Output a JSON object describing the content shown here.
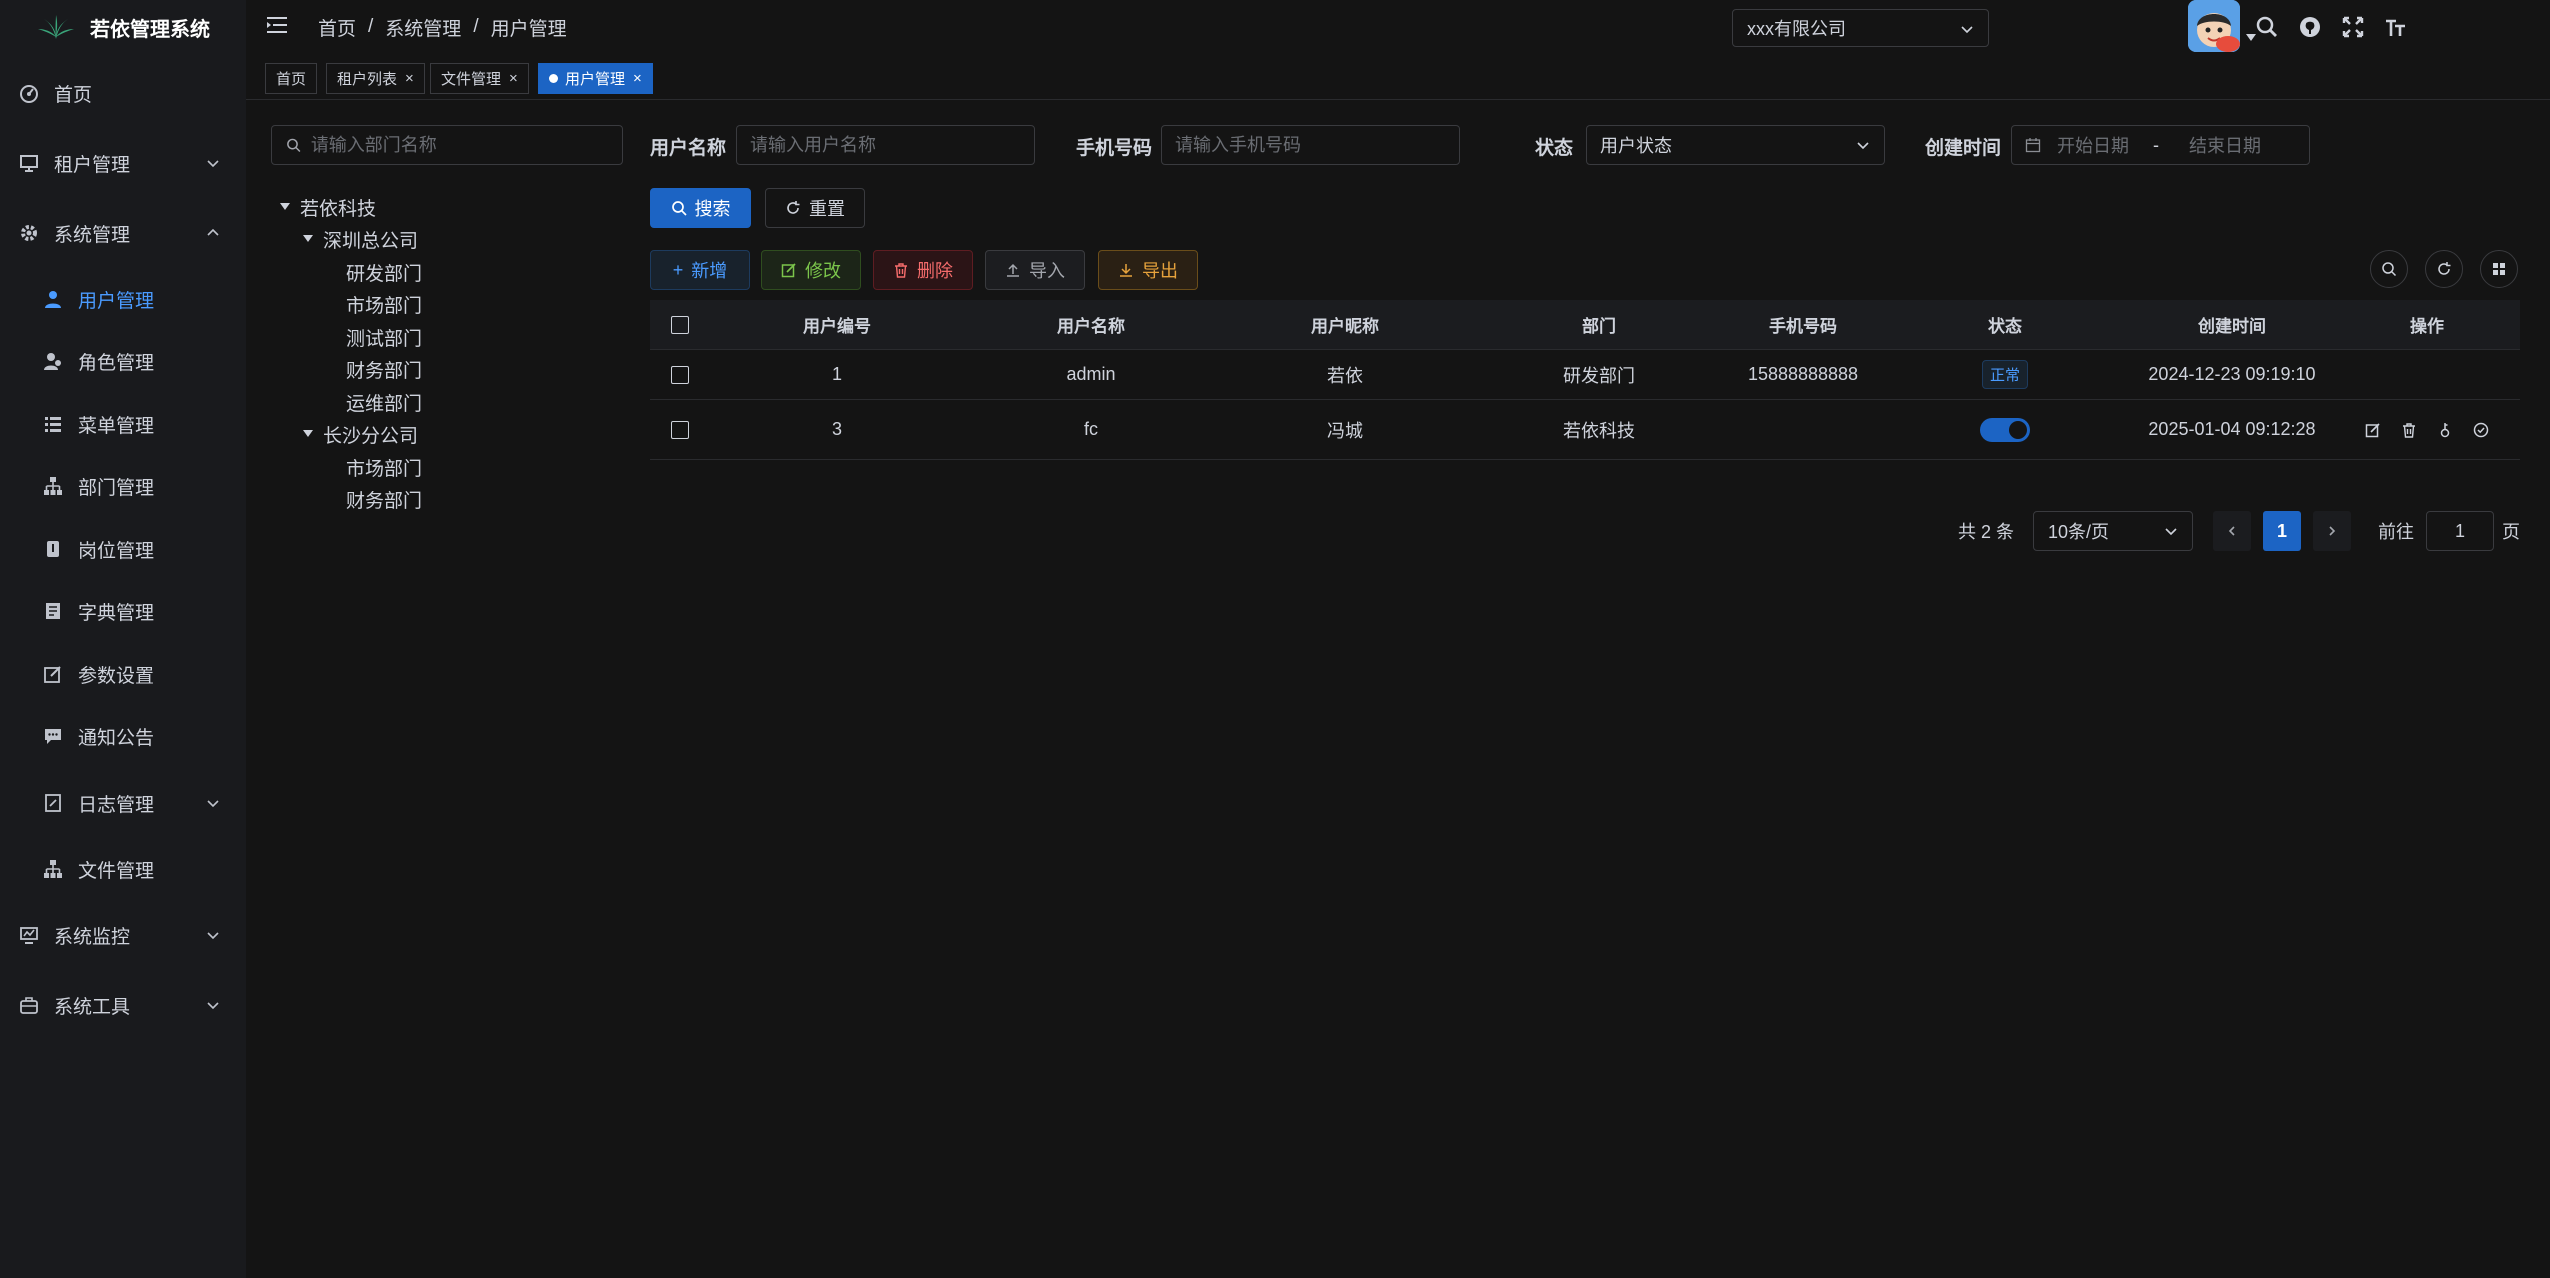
{
  "app": {
    "title": "若依管理系统"
  },
  "colors": {
    "accent": "#1c64c4",
    "bg": "#141414",
    "sidebar": "#191a1d"
  },
  "sidebar": {
    "items": [
      {
        "label": "首页",
        "icon": "dashboard-icon"
      },
      {
        "label": "租户管理",
        "icon": "tenant-icon"
      },
      {
        "label": "系统管理",
        "icon": "gear-icon"
      },
      {
        "label": "用户管理",
        "icon": "user-icon"
      },
      {
        "label": "角色管理",
        "icon": "role-icon"
      },
      {
        "label": "菜单管理",
        "icon": "menu-list-icon"
      },
      {
        "label": "部门管理",
        "icon": "tree-icon"
      },
      {
        "label": "岗位管理",
        "icon": "post-icon"
      },
      {
        "label": "字典管理",
        "icon": "dict-icon"
      },
      {
        "label": "参数设置",
        "icon": "edit-icon"
      },
      {
        "label": "通知公告",
        "icon": "message-icon"
      },
      {
        "label": "日志管理",
        "icon": "log-icon"
      },
      {
        "label": "文件管理",
        "icon": "tree-icon"
      },
      {
        "label": "系统监控",
        "icon": "monitor-icon"
      },
      {
        "label": "系统工具",
        "icon": "toolbox-icon"
      }
    ]
  },
  "header": {
    "breadcrumb": [
      "首页",
      "系统管理",
      "用户管理"
    ],
    "company": "xxx有限公司"
  },
  "tags": [
    {
      "label": "首页"
    },
    {
      "label": "租户列表"
    },
    {
      "label": "文件管理"
    },
    {
      "label": "用户管理"
    }
  ],
  "dept_tree": {
    "search_placeholder": "请输入部门名称",
    "nodes": [
      "若依科技",
      "深圳总公司",
      "研发部门",
      "市场部门",
      "测试部门",
      "财务部门",
      "运维部门",
      "长沙分公司",
      "市场部门",
      "财务部门"
    ]
  },
  "search_form": {
    "username_label": "用户名称",
    "username_placeholder": "请输入用户名称",
    "phone_label": "手机号码",
    "phone_placeholder": "请输入手机号码",
    "status_label": "状态",
    "status_placeholder": "用户状态",
    "created_label": "创建时间",
    "start_placeholder": "开始日期",
    "range_sep": "-",
    "end_placeholder": "结束日期",
    "search_btn": "搜索",
    "reset_btn": "重置"
  },
  "toolbar": {
    "add": "新增",
    "edit": "修改",
    "delete": "删除",
    "import": "导入",
    "export": "导出"
  },
  "table": {
    "columns": [
      "用户编号",
      "用户名称",
      "用户昵称",
      "部门",
      "手机号码",
      "状态",
      "创建时间",
      "操作"
    ],
    "rows": [
      {
        "id": "1",
        "username": "admin",
        "nickname": "若依",
        "dept": "研发部门",
        "phone": "15888888888",
        "status": "正常",
        "created": "2024-12-23 09:19:10"
      },
      {
        "id": "3",
        "username": "fc",
        "nickname": "冯城",
        "dept": "若依科技",
        "phone": "",
        "status": "",
        "created": "2025-01-04 09:12:28"
      }
    ]
  },
  "pagination": {
    "total": "共 2 条",
    "page_size": "10条/页",
    "current": "1",
    "goto_label": "前往",
    "goto_value": "1",
    "page_unit": "页"
  }
}
